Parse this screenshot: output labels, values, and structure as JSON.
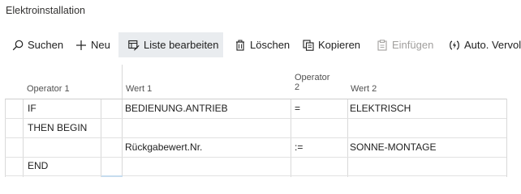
{
  "page": {
    "title": "Elektroinstallation"
  },
  "toolbar": {
    "search": "Suchen",
    "new": "Neu",
    "edit_list": "Liste bearbeiten",
    "delete": "Löschen",
    "copy": "Kopieren",
    "paste": "Einfügen",
    "auto_fill": "Auto. Vervollst"
  },
  "columns": {
    "operator1": "Operator 1",
    "wert1": "Wert 1",
    "operator2_line1": "Operator",
    "operator2_line2": "2",
    "wert2": "Wert 2"
  },
  "rows": [
    {
      "operator1": "IF",
      "wert1": "BEDIENUNG.ANTRIEB",
      "operator2": "=",
      "wert2": "ELEKTRISCH"
    },
    {
      "operator1": "THEN BEGIN",
      "wert1": "",
      "operator2": "",
      "wert2": ""
    },
    {
      "operator1": "",
      "wert1": "Rückgabewert.Nr.",
      "operator2": ":=",
      "wert2": "SONNE-MONTAGE"
    },
    {
      "operator1": "END",
      "wert1": "",
      "operator2": "",
      "wert2": ""
    }
  ]
}
